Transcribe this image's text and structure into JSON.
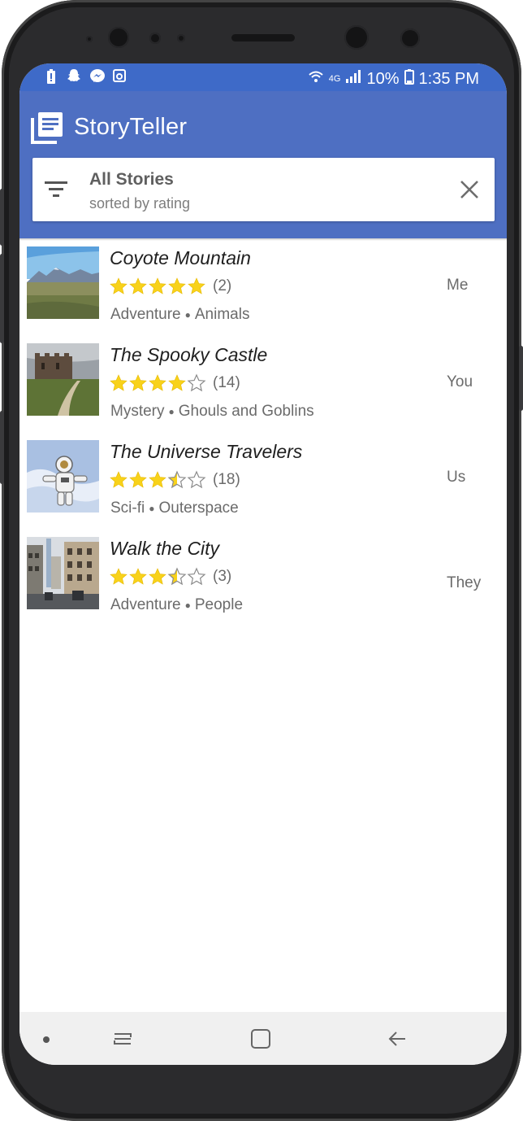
{
  "status_bar": {
    "notification_icons": [
      "battery-alert-icon",
      "snapchat-icon",
      "messenger-icon",
      "camera-icon"
    ],
    "network": "4G",
    "battery": "10%",
    "time": "1:35 PM"
  },
  "app": {
    "title": "StoryTeller",
    "brand_color": "#4e6fc2",
    "status_color": "#3e6ac8"
  },
  "filter": {
    "title": "All Stories",
    "subtitle": "sorted by rating"
  },
  "stories": [
    {
      "title": "Coyote Mountain",
      "rating": 5,
      "count": "(2)",
      "genre": "Adventure",
      "topic": "Animals",
      "author": "Me"
    },
    {
      "title": "The Spooky Castle",
      "rating": 4,
      "count": "(14)",
      "genre": "Mystery",
      "topic": "Ghouls and Goblins",
      "author": "You"
    },
    {
      "title": "The Universe Travelers",
      "rating": 3.5,
      "count": "(18)",
      "genre": "Sci-fi",
      "topic": "Outerspace",
      "author": "Us"
    },
    {
      "title": "Walk the City",
      "rating": 3.5,
      "count": "(3)",
      "genre": "Adventure",
      "topic": "People",
      "author": "They"
    }
  ],
  "star_color": "#f8d21a",
  "navbar": {
    "buttons": [
      "recent-apps-icon",
      "home-icon",
      "back-icon"
    ]
  }
}
